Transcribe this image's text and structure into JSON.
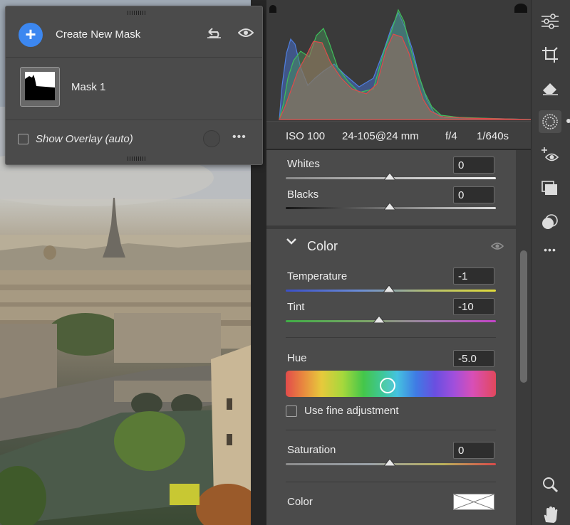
{
  "mask_panel": {
    "create_label": "Create New Mask",
    "mask_name": "Mask 1",
    "overlay_label": "Show Overlay (auto)",
    "more_label": "•••"
  },
  "histogram": {
    "iso": "ISO 100",
    "lens": "24-105@24 mm",
    "aperture": "f/4",
    "shutter": "1/640s"
  },
  "light": {
    "whites_label": "Whites",
    "whites_value": "0",
    "blacks_label": "Blacks",
    "blacks_value": "0"
  },
  "color": {
    "title": "Color",
    "temperature_label": "Temperature",
    "temperature_value": "-1",
    "tint_label": "Tint",
    "tint_value": "-10",
    "hue_label": "Hue",
    "hue_value": "-5.0",
    "fine_label": "Use fine adjustment",
    "saturation_label": "Saturation",
    "saturation_value": "0",
    "color_label": "Color"
  },
  "toolbar": {
    "more_label": "•••"
  },
  "colors": {
    "accent": "#3c87f0",
    "panel": "#4b4b4b",
    "background": "#262626"
  },
  "icons": [
    "adjust-sliders-icon",
    "crop-icon",
    "eraser-icon",
    "masking-icon",
    "redeye-icon",
    "presets-icon",
    "snapshot-icon",
    "more-icon",
    "zoom-icon",
    "hand-icon",
    "reset-icon",
    "eye-icon",
    "chevron-down-icon"
  ]
}
